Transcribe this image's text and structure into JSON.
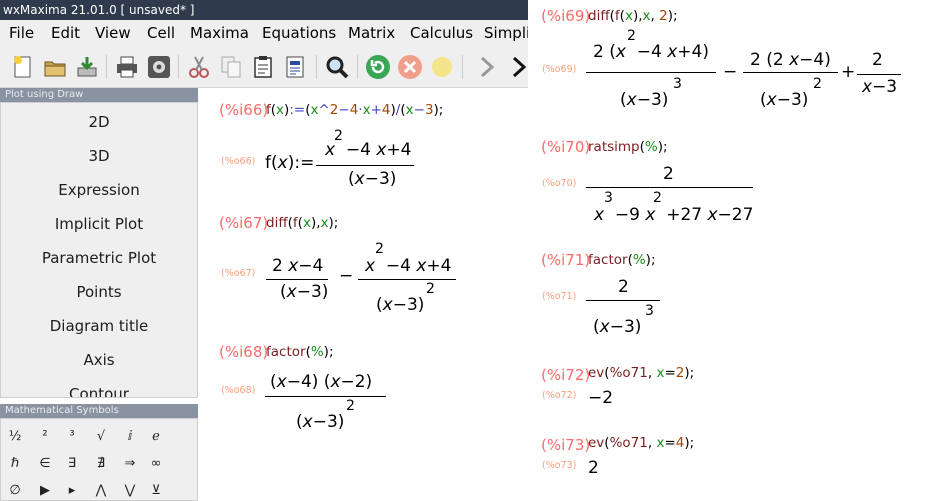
{
  "window": {
    "title": "wxMaxima 21.01.0 [ unsaved* ]"
  },
  "menu": [
    "File",
    "Edit",
    "View",
    "Cell",
    "Maxima",
    "Equations",
    "Matrix",
    "Calculus",
    "Simpli"
  ],
  "toolbar": [
    "new-icon",
    "open-icon",
    "save-icon",
    "print-icon",
    "config-icon",
    "cut-icon",
    "copy-icon",
    "paste-icon",
    "select-all-icon",
    "find-icon",
    "restart-icon",
    "interrupt-icon",
    "follow-icon",
    "back-icon",
    "forward-icon"
  ],
  "draw_panel": {
    "title": "Plot using Draw",
    "items": [
      "2D",
      "3D",
      "Expression",
      "Implicit Plot",
      "Parametric Plot",
      "Points",
      "Diagram title",
      "Axis",
      "Contour"
    ]
  },
  "symbols_panel": {
    "title": "Mathematical Symbols",
    "rows": [
      [
        "½",
        "²",
        "³",
        "√",
        "ⅈ",
        "ℯ"
      ],
      [
        "ℏ",
        "∈",
        "∃",
        "∄",
        "⇒",
        "∞"
      ],
      [
        "∅",
        "▶",
        "▸",
        "⋀",
        "⋁",
        "⊻"
      ]
    ]
  },
  "cells": {
    "i66": {
      "label": "(%i66)",
      "out": "(%o66)"
    },
    "i67": {
      "label": "(%i67)",
      "out": "(%o67)"
    },
    "i68": {
      "label": "(%i68)",
      "out": "(%o68)"
    },
    "i69": {
      "label": "(%i69)",
      "out": "(%o69)"
    },
    "i70": {
      "label": "(%i70)",
      "out": "(%o70)"
    },
    "i71": {
      "label": "(%i71)",
      "out": "(%o71)"
    },
    "i72": {
      "label": "(%i72)",
      "out": "(%o72)",
      "result": "−2"
    },
    "i73": {
      "label": "(%i73)",
      "out": "(%o73)",
      "result": "2"
    }
  }
}
